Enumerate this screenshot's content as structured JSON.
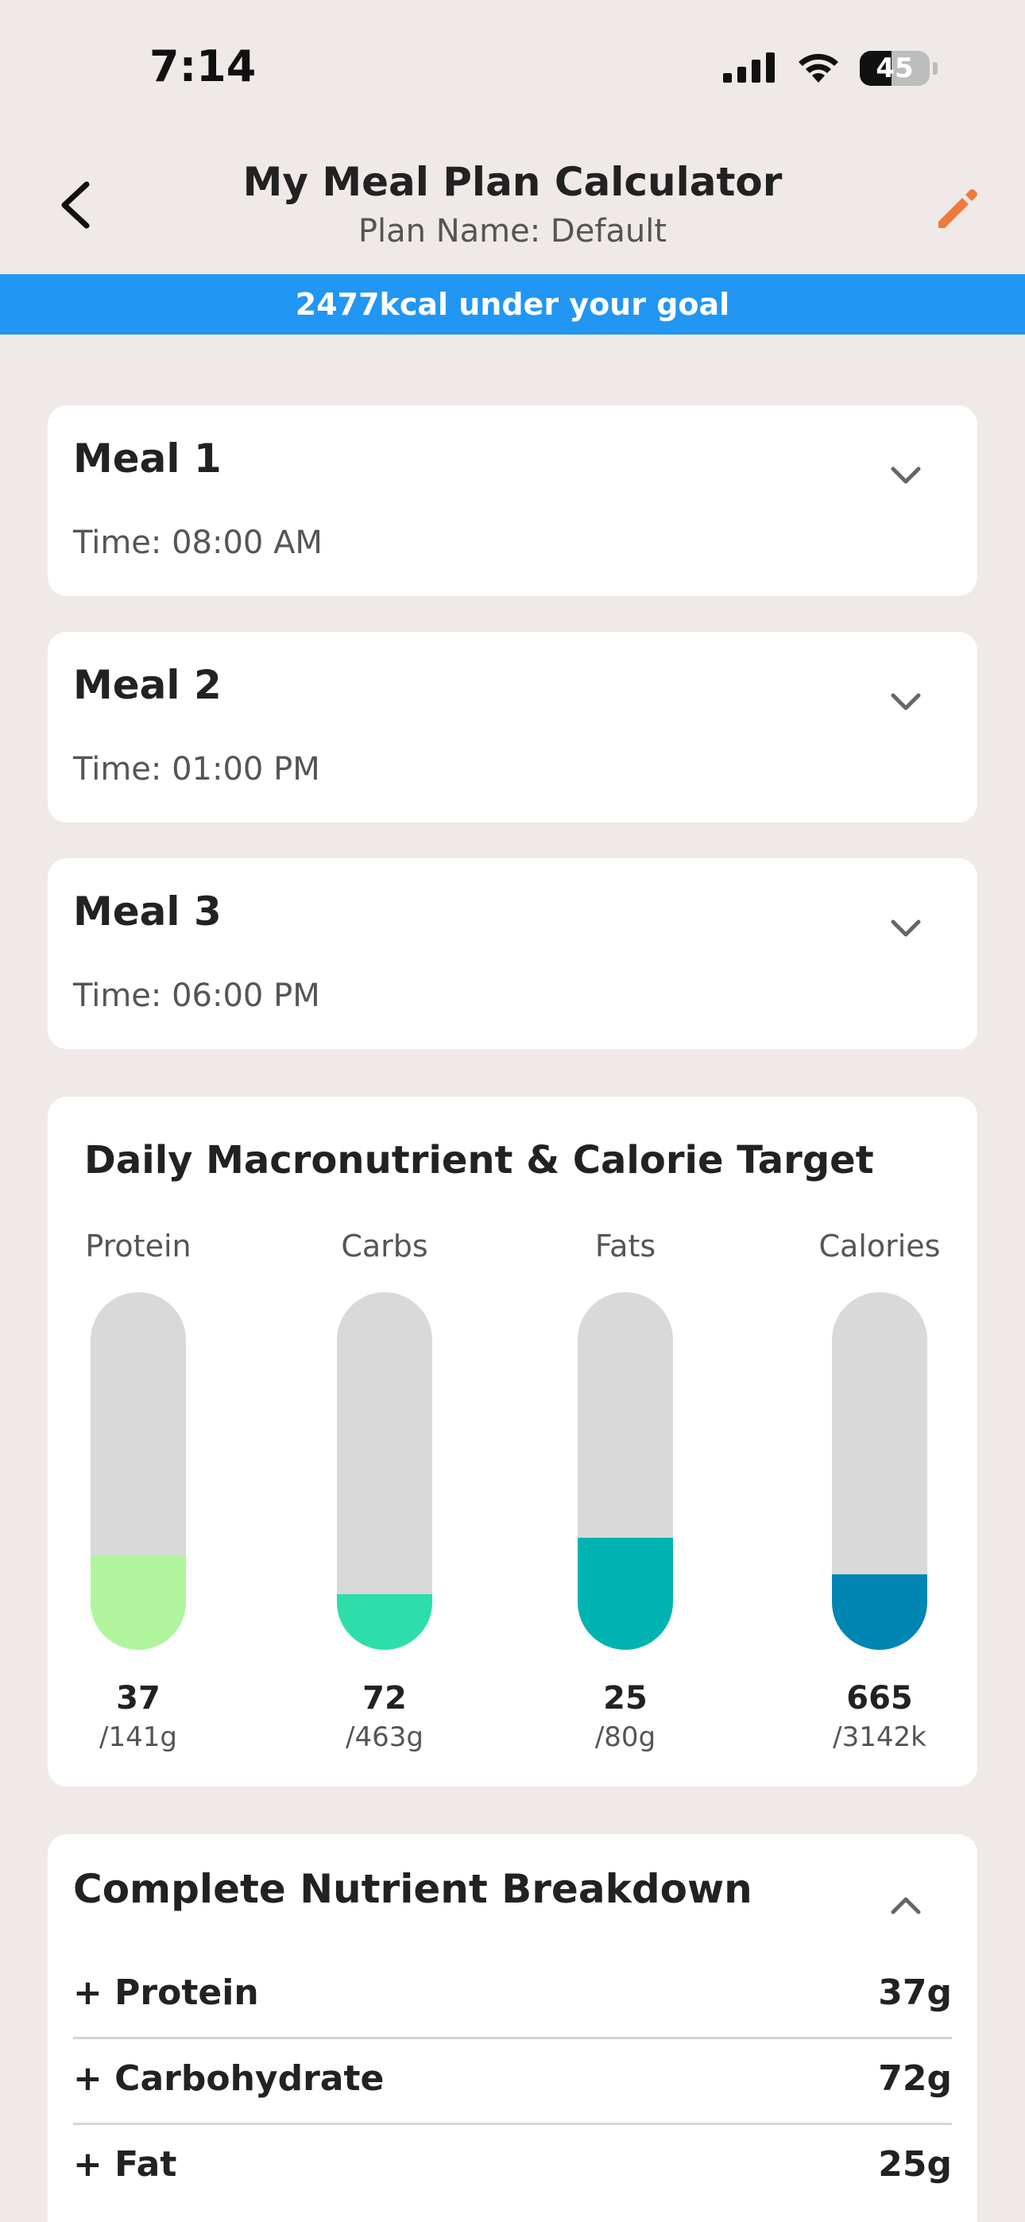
{
  "status_bar": {
    "time": "7:14",
    "battery_level": "45",
    "icons": [
      "signal-icon",
      "wifi-icon",
      "battery-icon"
    ]
  },
  "header": {
    "title": "My Meal Plan Calculator",
    "subtitle": "Plan Name: Default",
    "icons": [
      "back-arrow-icon",
      "pencil-icon"
    ],
    "accent_color": "#F0793C"
  },
  "goal_banner": {
    "text": "2477kcal under your goal",
    "color": "#2196F3"
  },
  "meals": [
    {
      "title": "Meal 1",
      "time": "Time: 08:00 AM"
    },
    {
      "title": "Meal 2",
      "time": "Time: 01:00 PM"
    },
    {
      "title": "Meal 3",
      "time": "Time: 06:00 PM"
    }
  ],
  "macros": {
    "title": "Daily Macronutrient & Calorie Target",
    "items": [
      {
        "label": "Protein",
        "value": "37",
        "target": "/141g",
        "fraction": 0.262,
        "color": "#B0F59E"
      },
      {
        "label": "Carbs",
        "value": "72",
        "target": "/463g",
        "fraction": 0.156,
        "color": "#2DDEAA"
      },
      {
        "label": "Fats",
        "value": "25",
        "target": "/80g",
        "fraction": 0.313,
        "color": "#00B3B3"
      },
      {
        "label": "Calories",
        "value": "665",
        "target": "/3142k",
        "fraction": 0.212,
        "color": "#0086B3"
      }
    ]
  },
  "breakdown": {
    "title": "Complete Nutrient Breakdown",
    "rows": [
      {
        "name": "+ Protein",
        "amount": "37g"
      },
      {
        "name": "+ Carbohydrate",
        "amount": "72g"
      },
      {
        "name": "+ Fat",
        "amount": "25g"
      }
    ]
  }
}
